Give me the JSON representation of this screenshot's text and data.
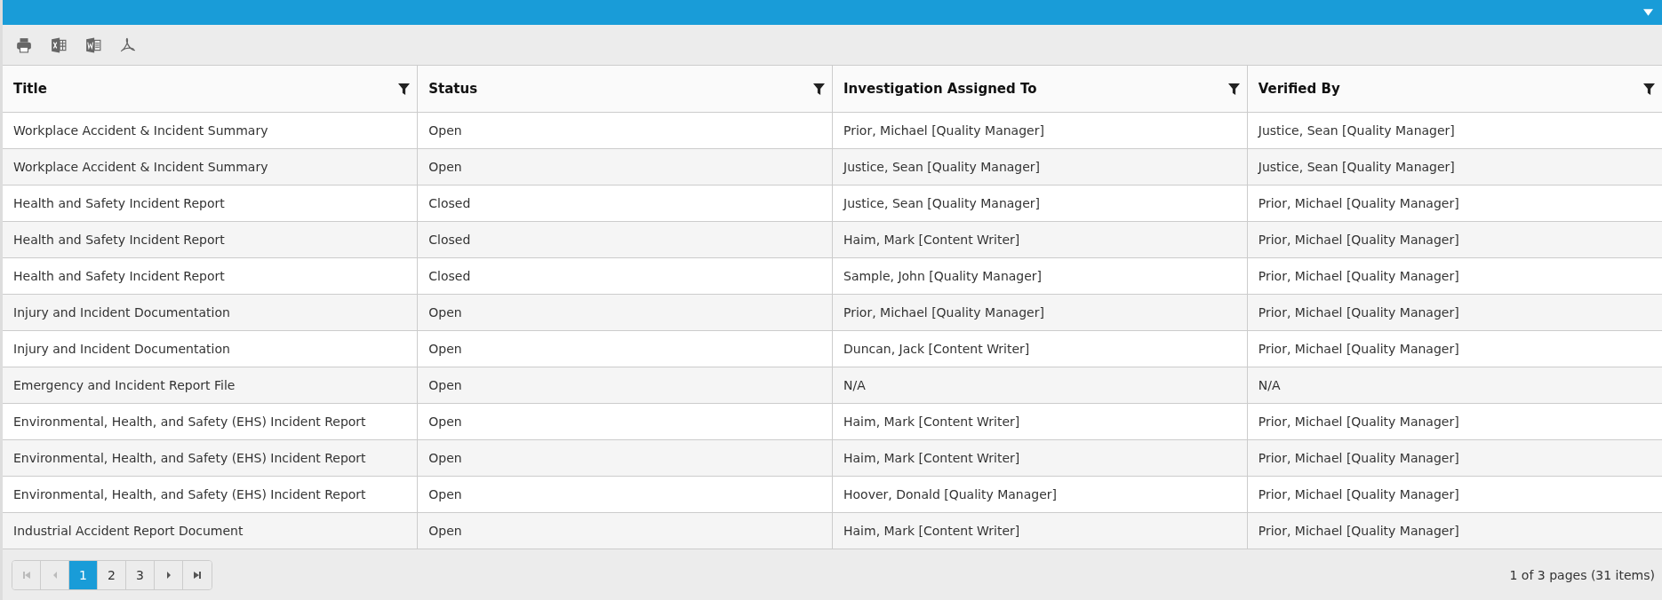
{
  "toolbar": {
    "tools": [
      {
        "kind": "print"
      },
      {
        "kind": "excel"
      },
      {
        "kind": "word"
      },
      {
        "kind": "pdf"
      }
    ]
  },
  "table": {
    "columns": [
      "Title",
      "Status",
      "Investigation Assigned To",
      "Verified By"
    ],
    "rows": [
      [
        "Workplace Accident & Incident Summary",
        "Open",
        "Prior, Michael [Quality Manager]",
        "Justice, Sean [Quality Manager]"
      ],
      [
        "Workplace Accident & Incident Summary",
        "Open",
        "Justice, Sean [Quality Manager]",
        "Justice, Sean [Quality Manager]"
      ],
      [
        "Health and Safety Incident Report",
        "Closed",
        "Justice, Sean [Quality Manager]",
        "Prior, Michael [Quality Manager]"
      ],
      [
        "Health and Safety Incident Report",
        "Closed",
        "Haim, Mark [Content Writer]",
        "Prior, Michael [Quality Manager]"
      ],
      [
        "Health and Safety Incident Report",
        "Closed",
        "Sample, John [Quality Manager]",
        "Prior, Michael [Quality Manager]"
      ],
      [
        "Injury and Incident Documentation",
        "Open",
        "Prior, Michael [Quality Manager]",
        "Prior, Michael [Quality Manager]"
      ],
      [
        "Injury and Incident Documentation",
        "Open",
        "Duncan, Jack [Content Writer]",
        "Prior, Michael [Quality Manager]"
      ],
      [
        "Emergency and Incident Report File",
        "Open",
        "N/A",
        "N/A"
      ],
      [
        "Environmental, Health, and Safety (EHS) Incident Report",
        "Open",
        "Haim, Mark [Content Writer]",
        "Prior, Michael [Quality Manager]"
      ],
      [
        "Environmental, Health, and Safety (EHS) Incident Report",
        "Open",
        "Haim, Mark [Content Writer]",
        "Prior, Michael [Quality Manager]"
      ],
      [
        "Environmental, Health, and Safety (EHS) Incident Report",
        "Open",
        "Hoover, Donald [Quality Manager]",
        "Prior, Michael [Quality Manager]"
      ],
      [
        "Industrial Accident Report Document",
        "Open",
        "Haim, Mark [Content Writer]",
        "Prior, Michael [Quality Manager]"
      ]
    ]
  },
  "pager": {
    "first": {
      "disabled": true
    },
    "previous": {
      "disabled": true
    },
    "pages": [
      {
        "label": "1",
        "selected": true
      },
      {
        "label": "2",
        "selected": false
      },
      {
        "label": "3",
        "selected": false
      }
    ],
    "next": {
      "disabled": false
    },
    "last": {
      "disabled": false
    },
    "info": "1 of 3 pages (31 items)"
  }
}
